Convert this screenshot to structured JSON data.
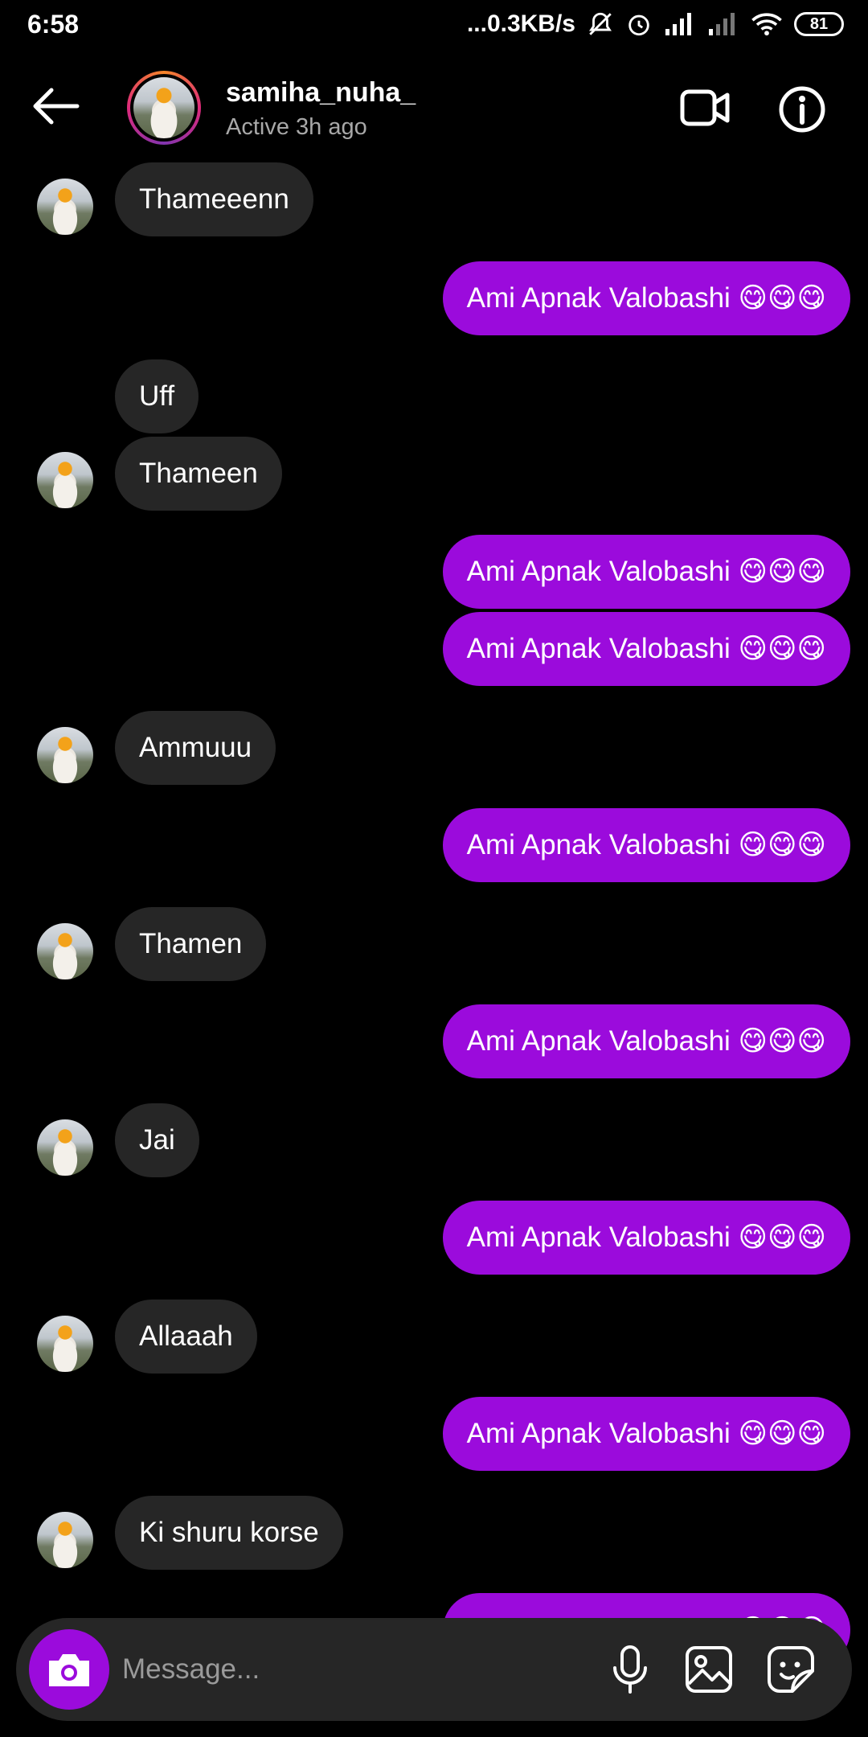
{
  "status_bar": {
    "time": "6:58",
    "network_speed": "...0.3KB/s",
    "battery": "81"
  },
  "header": {
    "username": "samiha_nuha_",
    "status": "Active 3h ago"
  },
  "messages": [
    {
      "side": "received",
      "text": "Thameeenn"
    },
    {
      "side": "sent",
      "text": "Ami Apnak Valobashi 😋😋😋"
    },
    {
      "side": "received",
      "text": "Uff"
    },
    {
      "side": "received",
      "text": "Thameen"
    },
    {
      "side": "sent",
      "text": "Ami Apnak Valobashi 😋😋😋"
    },
    {
      "side": "sent",
      "text": "Ami Apnak Valobashi 😋😋😋"
    },
    {
      "side": "received",
      "text": "Ammuuu"
    },
    {
      "side": "sent",
      "text": "Ami Apnak Valobashi 😋😋😋"
    },
    {
      "side": "received",
      "text": "Thamen"
    },
    {
      "side": "sent",
      "text": "Ami Apnak Valobashi 😋😋😋"
    },
    {
      "side": "received",
      "text": "Jai"
    },
    {
      "side": "sent",
      "text": "Ami Apnak Valobashi 😋😋😋"
    },
    {
      "side": "received",
      "text": "Allaaah"
    },
    {
      "side": "sent",
      "text": "Ami Apnak Valobashi 😋😋😋"
    },
    {
      "side": "received",
      "text": "Ki shuru korse"
    },
    {
      "side": "sent",
      "text": "Ami Apnak Valobashi 😋😋😋"
    }
  ],
  "composer": {
    "placeholder": "Message..."
  },
  "colors": {
    "sent_bubble": "#9b0bdc",
    "received_bubble": "#262626",
    "background": "#000000"
  },
  "icons": {
    "back": "arrow-left-icon",
    "video": "video-call-icon",
    "info": "info-icon",
    "camera": "camera-icon",
    "mic": "microphone-icon",
    "gallery": "gallery-icon",
    "sticker": "sticker-icon"
  }
}
